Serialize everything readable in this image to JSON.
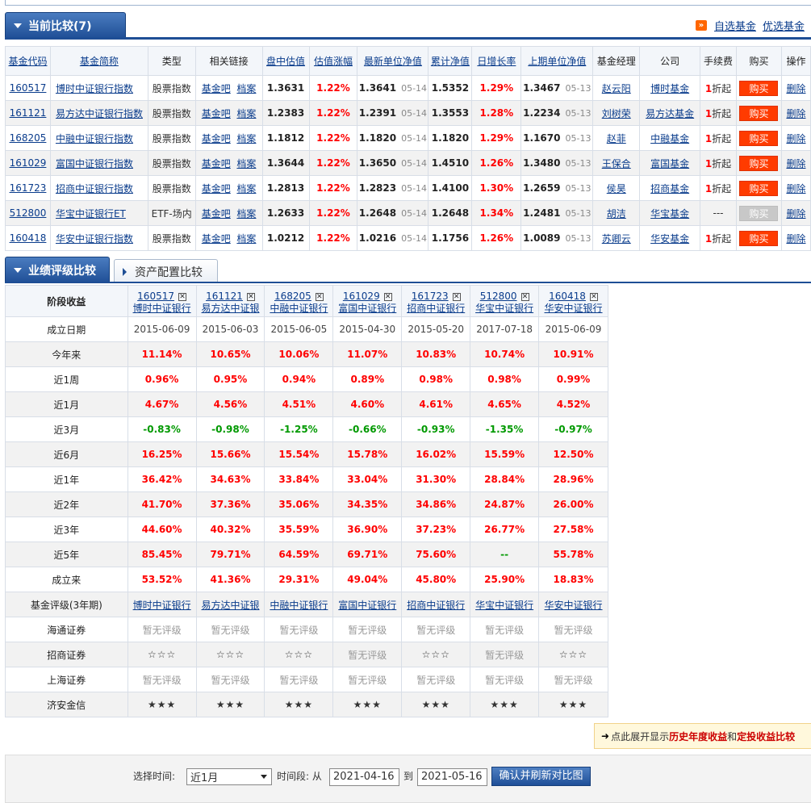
{
  "current_compare": {
    "tab_label": "当前比较(7)",
    "links": [
      "自选基金",
      "优选基金"
    ],
    "headers": [
      "基金代码",
      "基金简称",
      "类型",
      "相关链接",
      "盘中估值",
      "估值涨幅",
      "最新单位净值",
      "累计净值",
      "日增长率",
      "上期单位净值",
      "基金经理",
      "公司",
      "手续费",
      "购买",
      "操作"
    ],
    "link_labels": [
      "基金吧",
      "档案"
    ],
    "buy_label": "购买",
    "delete_label": "删除",
    "fee_suffix": "折起",
    "rows": [
      {
        "code": "160517",
        "name": "博时中证银行指数",
        "type": "股票指数",
        "est": "1.3631",
        "est_chg": "1.22%",
        "nav": "1.3641",
        "nav_date": "05-14",
        "acc": "1.5352",
        "daily": "1.29%",
        "prev_nav": "1.3467",
        "prev_date": "05-13",
        "manager": "赵云阳",
        "company": "博时基金",
        "fee_num": "1",
        "fee": true,
        "buy_enabled": true
      },
      {
        "code": "161121",
        "name": "易方达中证银行指数",
        "type": "股票指数",
        "est": "1.2383",
        "est_chg": "1.22%",
        "nav": "1.2391",
        "nav_date": "05-14",
        "acc": "1.3553",
        "daily": "1.28%",
        "prev_nav": "1.2234",
        "prev_date": "05-13",
        "manager": "刘树荣",
        "company": "易方达基金",
        "fee_num": "1",
        "fee": true,
        "buy_enabled": true
      },
      {
        "code": "168205",
        "name": "中融中证银行指数",
        "type": "股票指数",
        "est": "1.1812",
        "est_chg": "1.22%",
        "nav": "1.1820",
        "nav_date": "05-14",
        "acc": "1.1820",
        "daily": "1.29%",
        "prev_nav": "1.1670",
        "prev_date": "05-13",
        "manager": "赵菲",
        "company": "中融基金",
        "fee_num": "1",
        "fee": true,
        "buy_enabled": true
      },
      {
        "code": "161029",
        "name": "富国中证银行指数",
        "type": "股票指数",
        "est": "1.3644",
        "est_chg": "1.22%",
        "nav": "1.3650",
        "nav_date": "05-14",
        "acc": "1.4510",
        "daily": "1.26%",
        "prev_nav": "1.3480",
        "prev_date": "05-13",
        "manager": "王保合",
        "company": "富国基金",
        "fee_num": "1",
        "fee": true,
        "buy_enabled": true
      },
      {
        "code": "161723",
        "name": "招商中证银行指数",
        "type": "股票指数",
        "est": "1.2813",
        "est_chg": "1.22%",
        "nav": "1.2823",
        "nav_date": "05-14",
        "acc": "1.4100",
        "daily": "1.30%",
        "prev_nav": "1.2659",
        "prev_date": "05-13",
        "manager": "侯昊",
        "company": "招商基金",
        "fee_num": "1",
        "fee": true,
        "buy_enabled": true
      },
      {
        "code": "512800",
        "name": "华宝中证银行ET",
        "type": "ETF-场内",
        "est": "1.2633",
        "est_chg": "1.22%",
        "nav": "1.2648",
        "nav_date": "05-14",
        "acc": "1.2648",
        "daily": "1.34%",
        "prev_nav": "1.2481",
        "prev_date": "05-13",
        "manager": "胡洁",
        "company": "华宝基金",
        "fee_num": "",
        "fee_text": "---",
        "fee": false,
        "buy_enabled": false
      },
      {
        "code": "160418",
        "name": "华安中证银行指数",
        "type": "股票指数",
        "est": "1.0212",
        "est_chg": "1.22%",
        "nav": "1.0216",
        "nav_date": "05-14",
        "acc": "1.1756",
        "daily": "1.26%",
        "prev_nav": "1.0089",
        "prev_date": "05-13",
        "manager": "苏卿云",
        "company": "华安基金",
        "fee_num": "1",
        "fee": true,
        "buy_enabled": true
      }
    ]
  },
  "performance": {
    "tab_label": "业绩评级比较",
    "tab2_label": "资产配置比较",
    "stage_header": "阶段收益",
    "close_glyph": "✕",
    "funds": [
      {
        "code": "160517",
        "short": "博时中证银行"
      },
      {
        "code": "161121",
        "short": "易方达中证银"
      },
      {
        "code": "168205",
        "short": "中融中证银行"
      },
      {
        "code": "161029",
        "short": "富国中证银行"
      },
      {
        "code": "161723",
        "short": "招商中证银行"
      },
      {
        "code": "512800",
        "short": "华宝中证银行"
      },
      {
        "code": "160418",
        "short": "华安中证银行"
      }
    ],
    "inception_label": "成立日期",
    "inception_dates": [
      "2015-06-09",
      "2015-06-03",
      "2015-06-05",
      "2015-04-30",
      "2015-05-20",
      "2017-07-18",
      "2015-06-09"
    ],
    "return_rows": [
      {
        "label": "今年来",
        "values": [
          "11.14%",
          "10.65%",
          "10.06%",
          "11.07%",
          "10.83%",
          "10.74%",
          "10.91%"
        ]
      },
      {
        "label": "近1周",
        "values": [
          "0.96%",
          "0.95%",
          "0.94%",
          "0.89%",
          "0.98%",
          "0.98%",
          "0.99%"
        ]
      },
      {
        "label": "近1月",
        "values": [
          "4.67%",
          "4.56%",
          "4.51%",
          "4.60%",
          "4.61%",
          "4.65%",
          "4.52%"
        ]
      },
      {
        "label": "近3月",
        "values": [
          "-0.83%",
          "-0.98%",
          "-1.25%",
          "-0.66%",
          "-0.93%",
          "-1.35%",
          "-0.97%"
        ]
      },
      {
        "label": "近6月",
        "values": [
          "16.25%",
          "15.66%",
          "15.54%",
          "15.78%",
          "16.02%",
          "15.59%",
          "12.50%"
        ]
      },
      {
        "label": "近1年",
        "values": [
          "36.42%",
          "34.63%",
          "33.84%",
          "33.04%",
          "31.30%",
          "28.84%",
          "28.96%"
        ]
      },
      {
        "label": "近2年",
        "values": [
          "41.70%",
          "37.36%",
          "35.06%",
          "34.35%",
          "34.86%",
          "24.87%",
          "26.00%"
        ]
      },
      {
        "label": "近3年",
        "values": [
          "44.60%",
          "40.32%",
          "35.59%",
          "36.90%",
          "37.23%",
          "26.77%",
          "27.58%"
        ]
      },
      {
        "label": "近5年",
        "values": [
          "85.45%",
          "79.71%",
          "64.59%",
          "69.71%",
          "75.60%",
          "--",
          "55.78%"
        ]
      },
      {
        "label": "成立来",
        "values": [
          "53.52%",
          "41.36%",
          "29.31%",
          "49.04%",
          "45.80%",
          "25.90%",
          "18.83%"
        ]
      }
    ],
    "rating_header": "基金评级(3年期)",
    "rating_rows": [
      {
        "label": "海通证券",
        "values": [
          "暂无评级",
          "暂无评级",
          "暂无评级",
          "暂无评级",
          "暂无评级",
          "暂无评级",
          "暂无评级"
        ]
      },
      {
        "label": "招商证券",
        "values": [
          "☆☆☆",
          "☆☆☆",
          "☆☆☆",
          "暂无评级",
          "☆☆☆",
          "暂无评级",
          "☆☆☆"
        ]
      },
      {
        "label": "上海证券",
        "values": [
          "暂无评级",
          "暂无评级",
          "暂无评级",
          "暂无评级",
          "暂无评级",
          "暂无评级",
          "暂无评级"
        ]
      },
      {
        "label": "济安金信",
        "values": [
          "★★★",
          "★★★",
          "★★★",
          "★★★",
          "★★★",
          "★★★",
          "★★★"
        ]
      }
    ]
  },
  "expand": {
    "prefix": "点此展开显示",
    "hist": "历史年度收益",
    "and": "和",
    "plan": "定投收益比较"
  },
  "filter": {
    "time_label": "选择时间:",
    "period_value": "近1月",
    "range_label": "时间段: 从",
    "from": "2021-04-16",
    "to_label": "到",
    "to": "2021-05-16",
    "refresh_label": "确认并刷新对比图"
  }
}
